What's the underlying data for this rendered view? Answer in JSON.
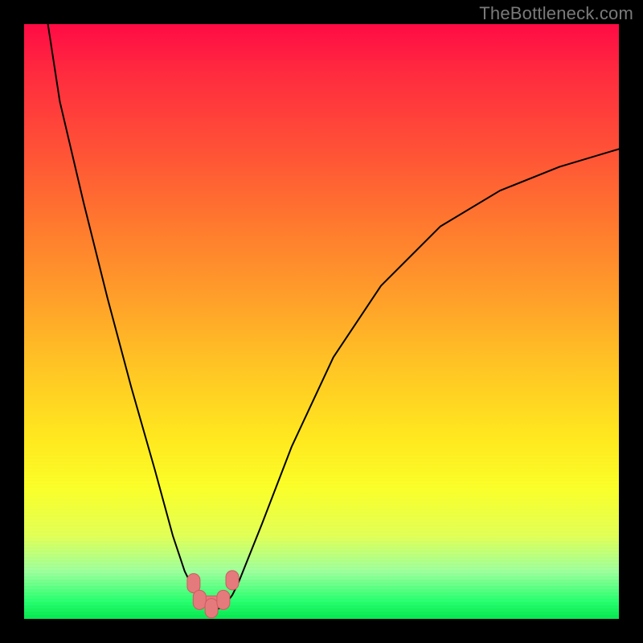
{
  "watermark": "TheBottleneck.com",
  "colors": {
    "frame": "#000000",
    "watermark_text": "#7a7a7a",
    "gradient_stops": [
      "#ff0b45",
      "#ff2a3f",
      "#ff5436",
      "#ff7a2e",
      "#ff9f2a",
      "#ffc624",
      "#ffe91f",
      "#fbff28",
      "#e1ff55",
      "#9cff9b",
      "#28ff6e",
      "#06e64e"
    ],
    "curve_stroke": "#000000",
    "marker_fill": "#e47a7c",
    "marker_stroke": "#cf5a60"
  },
  "chart_data": {
    "type": "line",
    "title": "",
    "xlabel": "",
    "ylabel": "",
    "xlim": [
      0,
      100
    ],
    "ylim": [
      0,
      100
    ],
    "grid": false,
    "legend": false,
    "note": "Axes are unlabeled in the source image. x and y are normalized to 0-100 matching pixel positions inside the plot area (y increases upward). Values estimated from the rendered curve.",
    "series": [
      {
        "name": "curve",
        "x": [
          4,
          6,
          10,
          14,
          18,
          22,
          25,
          27,
          29,
          30.5,
          32,
          33.5,
          35,
          36,
          40,
          45,
          52,
          60,
          70,
          80,
          90,
          100
        ],
        "y": [
          100,
          87,
          70,
          54,
          39,
          25,
          14,
          8,
          4,
          2,
          1.5,
          2,
          4,
          6,
          16,
          29,
          44,
          56,
          66,
          72,
          76,
          79
        ]
      }
    ],
    "markers": [
      {
        "name": "marker-left-upper",
        "x": 28.5,
        "y": 6.0
      },
      {
        "name": "marker-left-lower",
        "x": 29.5,
        "y": 3.2
      },
      {
        "name": "marker-bottom",
        "x": 31.5,
        "y": 1.8
      },
      {
        "name": "marker-right-lower",
        "x": 33.5,
        "y": 3.2
      },
      {
        "name": "marker-right-upper",
        "x": 35.0,
        "y": 6.5
      }
    ]
  }
}
